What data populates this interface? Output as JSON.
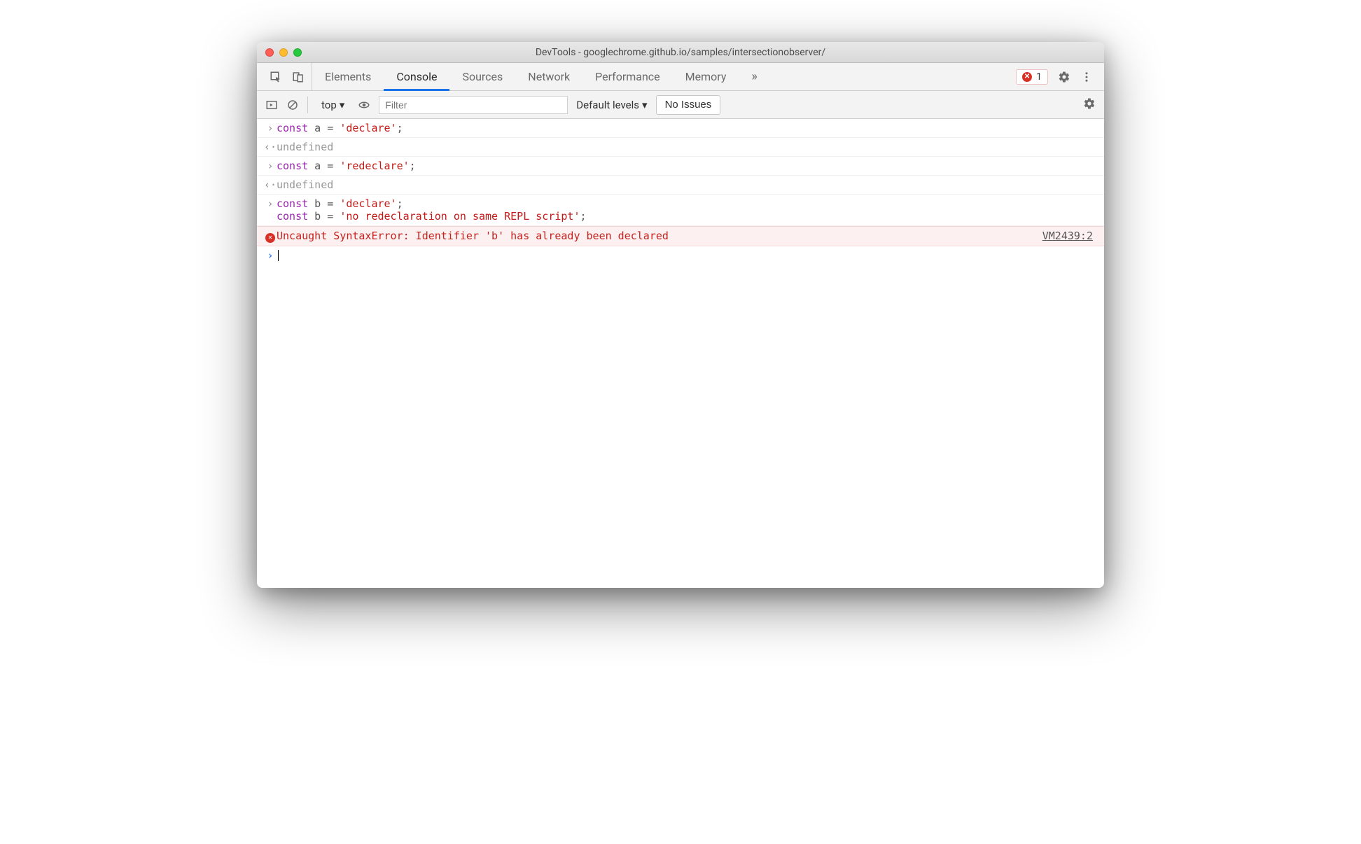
{
  "window": {
    "title": "DevTools - googlechrome.github.io/samples/intersectionobserver/"
  },
  "tabs": {
    "items": [
      "Elements",
      "Console",
      "Sources",
      "Network",
      "Performance",
      "Memory"
    ],
    "active": "Console",
    "overflow_glyph": "»",
    "error_count": "1"
  },
  "subbar": {
    "context": "top",
    "filter_placeholder": "Filter",
    "levels": "Default levels",
    "issues_button": "No Issues"
  },
  "console": {
    "rows": [
      {
        "type": "input",
        "code": [
          {
            "t": "const",
            "c": "kw"
          },
          {
            "t": " a ",
            "c": "op"
          },
          {
            "t": "=",
            "c": "op"
          },
          {
            "t": " ",
            "c": "op"
          },
          {
            "t": "'declare'",
            "c": "str"
          },
          {
            "t": ";",
            "c": "op"
          }
        ]
      },
      {
        "type": "output",
        "text": "undefined"
      },
      {
        "type": "input",
        "code": [
          {
            "t": "const",
            "c": "kw"
          },
          {
            "t": " a ",
            "c": "op"
          },
          {
            "t": "=",
            "c": "op"
          },
          {
            "t": " ",
            "c": "op"
          },
          {
            "t": "'redeclare'",
            "c": "str"
          },
          {
            "t": ";",
            "c": "op"
          }
        ]
      },
      {
        "type": "output",
        "text": "undefined"
      },
      {
        "type": "input",
        "code": [
          {
            "t": "const",
            "c": "kw"
          },
          {
            "t": " b ",
            "c": "op"
          },
          {
            "t": "=",
            "c": "op"
          },
          {
            "t": " ",
            "c": "op"
          },
          {
            "t": "'declare'",
            "c": "str"
          },
          {
            "t": ";",
            "c": "op"
          },
          {
            "t": "\n",
            "c": "op"
          },
          {
            "t": "const",
            "c": "kw"
          },
          {
            "t": " b ",
            "c": "op"
          },
          {
            "t": "=",
            "c": "op"
          },
          {
            "t": " ",
            "c": "op"
          },
          {
            "t": "'no redeclaration on same REPL script'",
            "c": "str"
          },
          {
            "t": ";",
            "c": "op"
          }
        ]
      },
      {
        "type": "error",
        "text": "Uncaught SyntaxError: Identifier 'b' has already been declared",
        "link": "VM2439:2"
      },
      {
        "type": "prompt"
      }
    ]
  }
}
